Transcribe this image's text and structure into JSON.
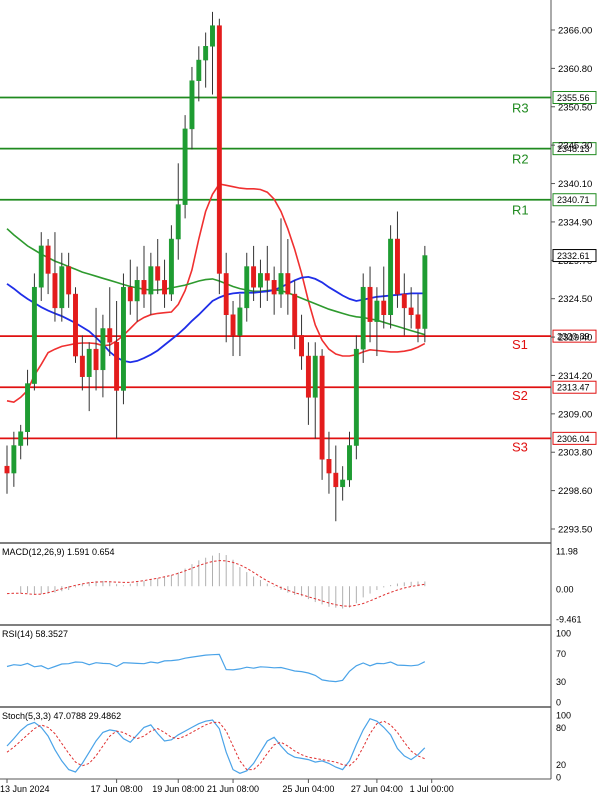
{
  "chart_data": {
    "type": "candlestick",
    "main": {
      "ylim": [
        2292.0,
        2369.0
      ],
      "yticks": [
        "2366.00",
        "2360.80",
        "2350.50",
        "2345.30",
        "2340.10",
        "2334.90",
        "2329.70",
        "2324.50",
        "2319.40",
        "2314.20",
        "2309.00",
        "2303.80",
        "2298.60",
        "2293.50"
      ],
      "current_price": "2332.61",
      "levels": [
        {
          "name": "R3",
          "value": 2355.56,
          "label": "2355.56",
          "kind": "resistance"
        },
        {
          "name": "R2",
          "value": 2348.13,
          "label": "2348.13",
          "kind": "resistance"
        },
        {
          "name": "R1",
          "value": 2340.71,
          "label": "2340.71",
          "kind": "resistance"
        },
        {
          "name": "S1",
          "value": 2320.89,
          "label": "2320.89",
          "kind": "support"
        },
        {
          "name": "S2",
          "value": 2313.47,
          "label": "2313.47",
          "kind": "support"
        },
        {
          "name": "S3",
          "value": 2306.04,
          "label": "2306.04",
          "kind": "support"
        }
      ],
      "candles": [
        [
          2302,
          2305,
          2298,
          2301
        ],
        [
          2301,
          2307,
          2299,
          2305
        ],
        [
          2305,
          2308,
          2303,
          2307
        ],
        [
          2307,
          2316,
          2305,
          2314
        ],
        [
          2314,
          2330,
          2313,
          2328
        ],
        [
          2328,
          2336,
          2326,
          2334
        ],
        [
          2334,
          2335,
          2327,
          2330
        ],
        [
          2330,
          2336,
          2323,
          2325
        ],
        [
          2325,
          2333,
          2323,
          2331
        ],
        [
          2331,
          2333,
          2325,
          2327
        ],
        [
          2327,
          2328,
          2317,
          2318
        ],
        [
          2318,
          2321,
          2313,
          2315
        ],
        [
          2315,
          2320,
          2310,
          2319
        ],
        [
          2319,
          2325,
          2313,
          2316
        ],
        [
          2316,
          2324,
          2312,
          2322
        ],
        [
          2322,
          2328,
          2318,
          2320
        ],
        [
          2320,
          2326,
          2306,
          2313
        ],
        [
          2313,
          2330,
          2311,
          2328
        ],
        [
          2328,
          2332,
          2324,
          2326
        ],
        [
          2326,
          2331,
          2323,
          2329
        ],
        [
          2329,
          2334,
          2325,
          2327
        ],
        [
          2327,
          2333,
          2324,
          2331
        ],
        [
          2331,
          2335,
          2327,
          2329
        ],
        [
          2329,
          2332,
          2325,
          2327
        ],
        [
          2327,
          2337,
          2326,
          2335
        ],
        [
          2335,
          2346,
          2332,
          2340
        ],
        [
          2340,
          2353,
          2338,
          2351
        ],
        [
          2351,
          2360,
          2348,
          2358
        ],
        [
          2358,
          2363,
          2355,
          2361
        ],
        [
          2361,
          2365,
          2357,
          2363
        ],
        [
          2363,
          2368,
          2356,
          2366
        ],
        [
          2366,
          2367,
          2327,
          2330
        ],
        [
          2330,
          2333,
          2320,
          2324
        ],
        [
          2324,
          2326,
          2318,
          2321
        ],
        [
          2321,
          2327,
          2318,
          2325
        ],
        [
          2325,
          2333,
          2323,
          2331
        ],
        [
          2331,
          2334,
          2326,
          2328
        ],
        [
          2328,
          2332,
          2325,
          2330
        ],
        [
          2330,
          2334,
          2326,
          2329
        ],
        [
          2329,
          2331,
          2324,
          2327
        ],
        [
          2327,
          2338,
          2325,
          2330
        ],
        [
          2330,
          2335,
          2324,
          2327
        ],
        [
          2327,
          2329,
          2319,
          2321
        ],
        [
          2321,
          2324,
          2316,
          2318
        ],
        [
          2318,
          2320,
          2308,
          2312
        ],
        [
          2312,
          2320,
          2306,
          2318
        ],
        [
          2318,
          2319,
          2300,
          2303
        ],
        [
          2303,
          2307,
          2298,
          2301
        ],
        [
          2301,
          2305,
          2294,
          2299
        ],
        [
          2299,
          2302,
          2297,
          2300
        ],
        [
          2300,
          2307,
          2299,
          2305
        ],
        [
          2305,
          2321,
          2303,
          2319
        ],
        [
          2319,
          2330,
          2317,
          2328
        ],
        [
          2328,
          2331,
          2320,
          2323
        ],
        [
          2323,
          2328,
          2318,
          2326
        ],
        [
          2326,
          2331,
          2322,
          2324
        ],
        [
          2324,
          2337,
          2322,
          2335
        ],
        [
          2335,
          2339,
          2325,
          2327
        ],
        [
          2327,
          2330,
          2321,
          2325
        ],
        [
          2325,
          2328,
          2322,
          2324
        ],
        [
          2324,
          2327,
          2320,
          2322
        ],
        [
          2322,
          2334,
          2320,
          2332.6
        ]
      ],
      "ma_green": [
        2336.5,
        2335.6,
        2334.8,
        2334.0,
        2333.4,
        2332.8,
        2332.3,
        2331.8,
        2331.4,
        2331.0,
        2330.6,
        2330.2,
        2329.9,
        2329.6,
        2329.3,
        2329.0,
        2328.7,
        2328.4,
        2328.1,
        2327.9,
        2327.7,
        2327.6,
        2327.6,
        2327.7,
        2327.9,
        2328.1,
        2328.3,
        2328.6,
        2328.9,
        2329.1,
        2329.2,
        2328.9,
        2328.5,
        2328.1,
        2327.8,
        2327.6,
        2327.4,
        2327.4,
        2327.5,
        2327.6,
        2327.5,
        2327.2,
        2326.8,
        2326.4,
        2326.0,
        2325.6,
        2325.2,
        2324.8,
        2324.5,
        2324.2,
        2323.9,
        2323.7,
        2323.6,
        2323.4,
        2323.2,
        2322.9,
        2322.6,
        2322.3,
        2322.0,
        2321.7,
        2321.4,
        2321.1
      ],
      "ma_blue": [
        2328.5,
        2327.8,
        2327.0,
        2326.3,
        2325.7,
        2325.1,
        2324.6,
        2324.2,
        2323.8,
        2323.3,
        2322.8,
        2322.2,
        2321.6,
        2320.7,
        2319.7,
        2318.6,
        2317.8,
        2317.3,
        2317.1,
        2317.3,
        2317.7,
        2318.2,
        2318.8,
        2319.6,
        2320.4,
        2321.2,
        2322.1,
        2323.1,
        2324.0,
        2325.0,
        2326.0,
        2326.5,
        2326.9,
        2327.1,
        2327.2,
        2327.2,
        2327.2,
        2327.3,
        2327.4,
        2327.6,
        2328.0,
        2328.5,
        2329.0,
        2329.4,
        2329.5,
        2329.2,
        2328.7,
        2328.0,
        2327.4,
        2326.8,
        2326.3,
        2326.0,
        2326.2,
        2326.4,
        2326.6,
        2326.7,
        2326.8,
        2326.9,
        2327.0,
        2327.1,
        2327.1,
        2327.1
      ],
      "bb_red": [
        2311.5,
        2311.3,
        2312.0,
        2313.0,
        2315.2,
        2316.8,
        2318.5,
        2319.0,
        2319.4,
        2319.6,
        2319.8,
        2319.9,
        2319.9,
        2319.8,
        2319.5,
        2319.6,
        2320.2,
        2321.0,
        2322.0,
        2323.0,
        2323.6,
        2324.0,
        2324.2,
        2324.3,
        2324.4,
        2325.5,
        2327.5,
        2330.5,
        2335.0,
        2339.0,
        2341.5,
        2343.0,
        2342.8,
        2342.6,
        2342.4,
        2342.3,
        2342.3,
        2342.2,
        2341.8,
        2340.8,
        2339.0,
        2336.5,
        2333.5,
        2330.0,
        2326.0,
        2322.5,
        2320.3,
        2319.0,
        2318.3,
        2318.0,
        2318.0,
        2318.2,
        2318.6,
        2318.9,
        2318.8,
        2318.7,
        2318.6,
        2318.6,
        2318.7,
        2318.9,
        2319.3,
        2319.8
      ]
    },
    "macd": {
      "label": "MACD(12,26,9) 1.591 0.654",
      "yticks": [
        "11.98",
        "0.00",
        "-9.461"
      ],
      "ylim": [
        -11.5,
        13.0
      ],
      "histogram": [
        0.0,
        0.0,
        -2.4,
        -2.3,
        -2.8,
        -2.7,
        -2.5,
        -2.2,
        -1.7,
        -1.3,
        -0.4,
        0.7,
        1.4,
        1.8,
        1.8,
        1.4,
        0.7,
        0.3,
        0.8,
        1.3,
        1.8,
        2.3,
        2.7,
        3.3,
        3.7,
        4.7,
        6.0,
        7.5,
        8.8,
        9.7,
        10.4,
        11.3,
        10.6,
        9.0,
        6.5,
        4.8,
        3.3,
        2.1,
        0.9,
        -0.3,
        -1.3,
        -2.2,
        -3.0,
        -3.4,
        -4.4,
        -5.4,
        -6.2,
        -7.0,
        -7.3,
        -7.6,
        -7.3,
        -5.8,
        -3.8,
        -2.5,
        -1.3,
        -0.4,
        0.4,
        0.9,
        1.3,
        1.5,
        1.6,
        1.6
      ],
      "signal": [
        -2.5,
        -2.4,
        -2.4,
        -2.6,
        -2.8,
        -2.7,
        -2.2,
        -1.6,
        -0.9,
        -0.3,
        0.3,
        0.8,
        1.2,
        1.4,
        1.5,
        1.5,
        1.4,
        1.3,
        1.3,
        1.6,
        1.9,
        2.3,
        2.7,
        3.2,
        3.7,
        4.4,
        5.2,
        6.1,
        7.0,
        7.8,
        8.4,
        8.7,
        8.6,
        8.1,
        7.3,
        6.1,
        4.7,
        3.2,
        1.8,
        0.6,
        -0.5,
        -1.4,
        -2.2,
        -2.9,
        -3.6,
        -4.3,
        -5.0,
        -5.7,
        -6.3,
        -6.7,
        -6.8,
        -6.5,
        -5.9,
        -5.0,
        -4.0,
        -3.0,
        -2.1,
        -1.3,
        -0.6,
        -0.1,
        0.3,
        0.654
      ]
    },
    "rsi": {
      "label": "RSI(14) 58.3527",
      "yticks": [
        "100",
        "70",
        "30",
        "0"
      ],
      "ylim": [
        0,
        100
      ],
      "values": [
        51.5,
        54.0,
        53.0,
        56.0,
        51.0,
        52.5,
        48.0,
        51.5,
        55.0,
        55.5,
        58.0,
        57.5,
        54.0,
        57.0,
        56.0,
        55.5,
        51.5,
        57.0,
        56.5,
        56.0,
        55.5,
        58.0,
        56.5,
        59.5,
        60.0,
        61.0,
        63.5,
        65.0,
        66.5,
        68.0,
        68.5,
        69.0,
        47.0,
        46.5,
        48.0,
        50.5,
        49.0,
        51.0,
        50.5,
        49.5,
        50.0,
        47.5,
        45.0,
        44.0,
        42.0,
        38.5,
        32.0,
        30.5,
        29.5,
        31.5,
        44.5,
        52.5,
        56.5,
        52.5,
        56.0,
        55.5,
        58.0,
        53.5,
        53.0,
        52.5,
        53.5,
        58.35
      ]
    },
    "stoch": {
      "label": "Stoch(5,3,3) 47.0788 29.4862",
      "yticks": [
        "100",
        "80",
        "20",
        "0"
      ],
      "ylim": [
        0,
        100
      ],
      "k": [
        50,
        62,
        75,
        84,
        88,
        80,
        66,
        44,
        26,
        12,
        8,
        22,
        40,
        58,
        72,
        76,
        74,
        62,
        56,
        68,
        80,
        84,
        70,
        58,
        60,
        68,
        74,
        80,
        86,
        90,
        92,
        78,
        40,
        12,
        6,
        10,
        22,
        40,
        58,
        64,
        50,
        38,
        32,
        30,
        28,
        24,
        26,
        22,
        16,
        12,
        26,
        52,
        76,
        94,
        90,
        80,
        68,
        46,
        34,
        28,
        36,
        47.08
      ],
      "d": [
        40,
        48,
        58,
        68,
        78,
        84,
        80,
        70,
        54,
        38,
        24,
        18,
        22,
        34,
        50,
        66,
        74,
        72,
        66,
        62,
        66,
        74,
        78,
        72,
        64,
        62,
        66,
        72,
        78,
        84,
        88,
        88,
        74,
        50,
        26,
        12,
        12,
        22,
        38,
        52,
        56,
        50,
        42,
        36,
        32,
        30,
        28,
        26,
        24,
        20,
        18,
        28,
        48,
        70,
        86,
        90,
        84,
        72,
        56,
        42,
        34,
        29.49
      ]
    },
    "x_labels": [
      "13 Jun 2024",
      "17 Jun 08:00",
      "19 Jun 08:00",
      "21 Jun 08:00",
      "25 Jun 04:00",
      "27 Jun 04:00",
      "1 Jul 00:00"
    ],
    "x_label_positions": [
      0,
      16,
      25,
      33,
      44,
      54,
      62
    ],
    "colors": {
      "bull": "#1e9c32",
      "bear": "#e31c1c",
      "ma_green": "#2e9a2e",
      "ma_blue": "#1f2ee8",
      "bb_red": "#f03030",
      "resistance": "#1f8a1f",
      "support": "#e01010",
      "indicator_main": "#4aa3e8",
      "indicator_signal": "#e03030"
    }
  }
}
